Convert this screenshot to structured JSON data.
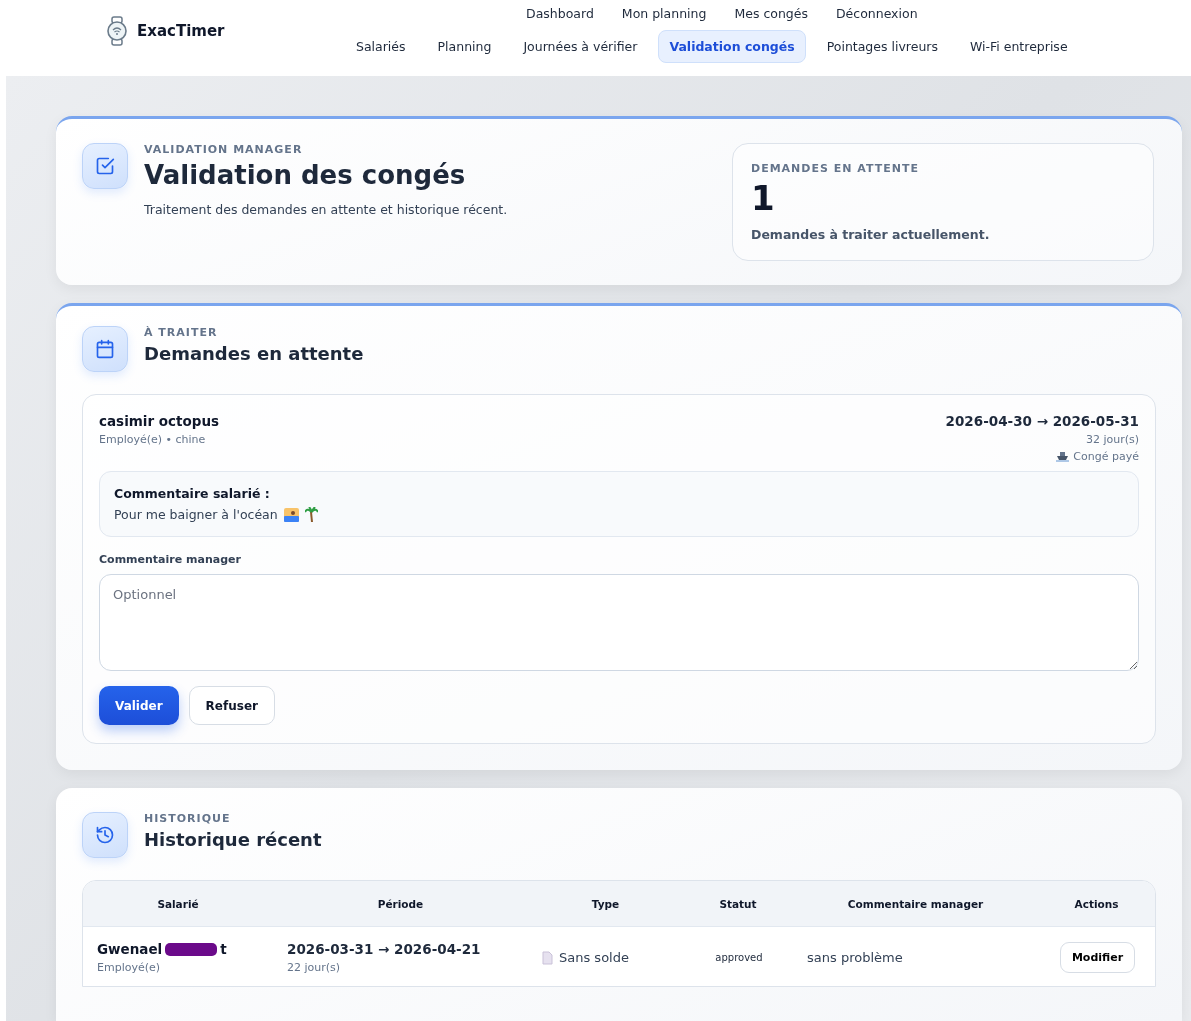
{
  "brand": {
    "name": "ExacTimer"
  },
  "nav_top": [
    {
      "label": "Dashboard"
    },
    {
      "label": "Mon planning"
    },
    {
      "label": "Mes congés"
    },
    {
      "label": "Déconnexion"
    }
  ],
  "nav_main": [
    {
      "label": "Salariés",
      "selected": false
    },
    {
      "label": "Planning",
      "selected": false
    },
    {
      "label": "Journées à vérifier",
      "selected": false
    },
    {
      "label": "Validation congés",
      "selected": true
    },
    {
      "label": "Pointages livreurs",
      "selected": false
    },
    {
      "label": "Wi-Fi entreprise",
      "selected": false
    }
  ],
  "hero": {
    "eyebrow": "VALIDATION MANAGER",
    "title": "Validation des congés",
    "subtitle": "Traitement des demandes en attente et historique récent.",
    "stat": {
      "label": "DEMANDES EN ATTENTE",
      "value": "1",
      "caption": "Demandes à traiter actuellement."
    }
  },
  "pending": {
    "eyebrow": "À TRAITER",
    "title": "Demandes en attente",
    "requests": [
      {
        "name": "casimir octopus",
        "meta": "Employé(e) • chine",
        "period": "2026-04-30 → 2026-05-31",
        "days": "32 jour(s)",
        "type": "Congé payé",
        "comment_label": "Commentaire salarié :",
        "comment": "Pour me baigner à l'océan",
        "manager_label": "Commentaire manager",
        "manager_placeholder": "Optionnel",
        "buttons": [
          {
            "label": "Valider",
            "kind": "primary"
          },
          {
            "label": "Refuser",
            "kind": "secondary"
          }
        ]
      }
    ]
  },
  "history": {
    "eyebrow": "HISTORIQUE",
    "title": "Historique récent",
    "columns": [
      "Salarié",
      "Période",
      "Type",
      "Statut",
      "Commentaire manager",
      "Actions"
    ],
    "rows": [
      {
        "name_start": "Gwenael",
        "name_end": "t",
        "redacted": true,
        "role": "Employé(e)",
        "period": "2026-03-31 → 2026-04-21",
        "days": "22 jour(s)",
        "type": "Sans solde",
        "status": "approved",
        "comment": "sans problème",
        "action": "Modifier"
      }
    ]
  }
}
